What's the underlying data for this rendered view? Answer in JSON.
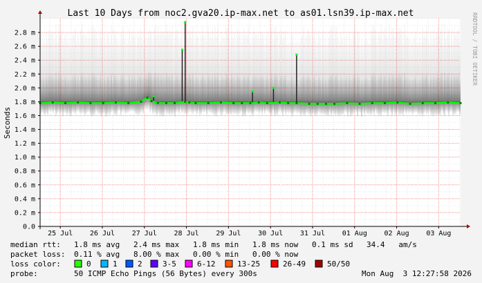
{
  "chart_data": {
    "type": "line",
    "title": "Last 10 Days from noc2.gva20.ip-max.net to as01.lsn39.ip-max.net",
    "ylabel": "Seconds",
    "xlabel": "",
    "side_label": "RRDTOOL / TOBI OETIKER",
    "ylim": [
      0,
      0.003
    ],
    "y_ticks": [
      {
        "v": 0,
        "label": "0.0"
      },
      {
        "v": 0.0002,
        "label": "0.2 m"
      },
      {
        "v": 0.0004,
        "label": "0.4 m"
      },
      {
        "v": 0.0006,
        "label": "0.6 m"
      },
      {
        "v": 0.0008,
        "label": "0.8 m"
      },
      {
        "v": 0.001,
        "label": "1.0 m"
      },
      {
        "v": 0.0012,
        "label": "1.2 m"
      },
      {
        "v": 0.0014,
        "label": "1.4 m"
      },
      {
        "v": 0.0016,
        "label": "1.6 m"
      },
      {
        "v": 0.0018,
        "label": "1.8 m"
      },
      {
        "v": 0.002,
        "label": "2.0 m"
      },
      {
        "v": 0.0022,
        "label": "2.2 m"
      },
      {
        "v": 0.0024,
        "label": "2.4 m"
      },
      {
        "v": 0.0026,
        "label": "2.6 m"
      },
      {
        "v": 0.0028,
        "label": "2.8 m"
      }
    ],
    "x_range": [
      "2026-07-24 12:27",
      "2026-08-03 12:27"
    ],
    "x_ticks": [
      "25 Jul",
      "26 Jul",
      "27 Jul",
      "28 Jul",
      "29 Jul",
      "30 Jul",
      "31 Jul",
      "01 Aug",
      "02 Aug",
      "03 Aug"
    ],
    "x_tick_days": [
      0.48,
      1.48,
      2.48,
      3.48,
      4.48,
      5.48,
      6.48,
      7.48,
      8.48,
      9.48
    ],
    "grid": true,
    "series": [
      {
        "name": "median rtt",
        "x_days": [
          0,
          0.3,
          0.6,
          0.9,
          1.2,
          1.5,
          1.8,
          2.1,
          2.4,
          2.55,
          2.65,
          2.8,
          3.0,
          3.2,
          3.45,
          3.55,
          3.7,
          4.0,
          4.3,
          4.6,
          4.8,
          5.0,
          5.2,
          5.4,
          5.7,
          5.9,
          6.1,
          6.4,
          6.6,
          6.8,
          7.0,
          7.3,
          7.6,
          7.9,
          8.2,
          8.5,
          8.8,
          9.1,
          9.4,
          9.7,
          10.0
        ],
        "values": [
          0.00178,
          0.00179,
          0.00178,
          0.00179,
          0.00178,
          0.00178,
          0.00179,
          0.00178,
          0.0018,
          0.00186,
          0.00181,
          0.00178,
          0.00178,
          0.00178,
          0.0018,
          0.00179,
          0.00178,
          0.00178,
          0.00179,
          0.00178,
          0.00178,
          0.00178,
          0.00179,
          0.00178,
          0.00179,
          0.00178,
          0.00178,
          0.00177,
          0.00177,
          0.00177,
          0.00177,
          0.00178,
          0.00177,
          0.00178,
          0.00178,
          0.00179,
          0.00177,
          0.00178,
          0.00178,
          0.00179,
          0.00178
        ]
      }
    ],
    "spikes": [
      {
        "day": 3.38,
        "value": 0.00255
      },
      {
        "day": 3.45,
        "value": 0.00295
      },
      {
        "day": 6.1,
        "value": 0.00248
      },
      {
        "day": 5.55,
        "value": 0.002
      },
      {
        "day": 5.05,
        "value": 0.00195
      },
      {
        "day": 2.7,
        "value": 0.00188
      }
    ],
    "colors": {
      "background": "#f3f3f3",
      "canvas": "#ffffff",
      "median_line": "#00ff00",
      "smoke_dark": "#333333",
      "smoke_light": "#cccccc",
      "grid_major": "#ff9999",
      "grid_minor": "#e5e5e5",
      "axis": "#000000"
    }
  },
  "legend": {
    "median_rtt": {
      "label": "median rtt:",
      "avg": "1.8 ms avg",
      "max": "2.4 ms max",
      "min": "1.8 ms min",
      "now": "1.8 ms now",
      "sd": "0.1 ms sd",
      "am_s": "34.4   am/s"
    },
    "packet_loss": {
      "label": "packet loss:",
      "avg": "0.11 % avg",
      "max": "8.00 % max",
      "min": "0.00 % min",
      "now": "0.00 % now"
    },
    "loss_color": {
      "label": "loss color:",
      "items": [
        {
          "label": "0",
          "color": "#26ff00"
        },
        {
          "label": "1",
          "color": "#00b8ff"
        },
        {
          "label": "2",
          "color": "#0059ff"
        },
        {
          "label": "3-5",
          "color": "#5e00ff"
        },
        {
          "label": "6-12",
          "color": "#ff00ff"
        },
        {
          "label": "13-25",
          "color": "#ff5500"
        },
        {
          "label": "26-49",
          "color": "#ff0000"
        },
        {
          "label": "50/50",
          "color": "#a10000"
        }
      ]
    },
    "probe": {
      "label": "probe:",
      "text": "50 ICMP Echo Pings (56 Bytes) every 300s",
      "timestamp": "Mon Aug  3 12:27:58 2026"
    }
  }
}
